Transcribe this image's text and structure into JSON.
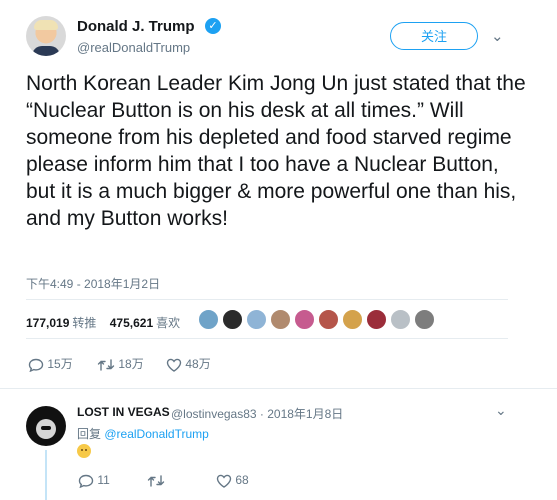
{
  "header": {
    "display_name": "Donald J. Trump",
    "verified_icon": "verified-badge-icon",
    "handle": "@realDonaldTrump",
    "follow_label": "关注",
    "caret": "∨"
  },
  "tweet": {
    "text": "North Korean Leader Kim Jong Un just stated that the “Nuclear Button is on his desk at all times.” Will someone from his depleted and food starved regime please inform him that I too have a Nuclear Button, but it is a much bigger & more powerful one than his, and my Button works!",
    "timestamp": "下午4:49 - 2018年1月2日"
  },
  "stats": {
    "retweets_count": "177,019",
    "retweets_label": "转推",
    "likes_count": "475,621",
    "likes_label": "喜欢"
  },
  "actions": {
    "reply_count": "15万",
    "retweet_count": "18万",
    "like_count": "48万"
  },
  "reply": {
    "display_name": "LOST IN VEGAS",
    "handle_time": "@lostinvegas83 · 2018年1月8日",
    "reply_prefix": "回复",
    "reply_to": "@realDonaldTrump",
    "reply_count": "11",
    "like_count": "68"
  },
  "colors": {
    "accent": "#1da1f2",
    "secondary_text": "#657786"
  }
}
